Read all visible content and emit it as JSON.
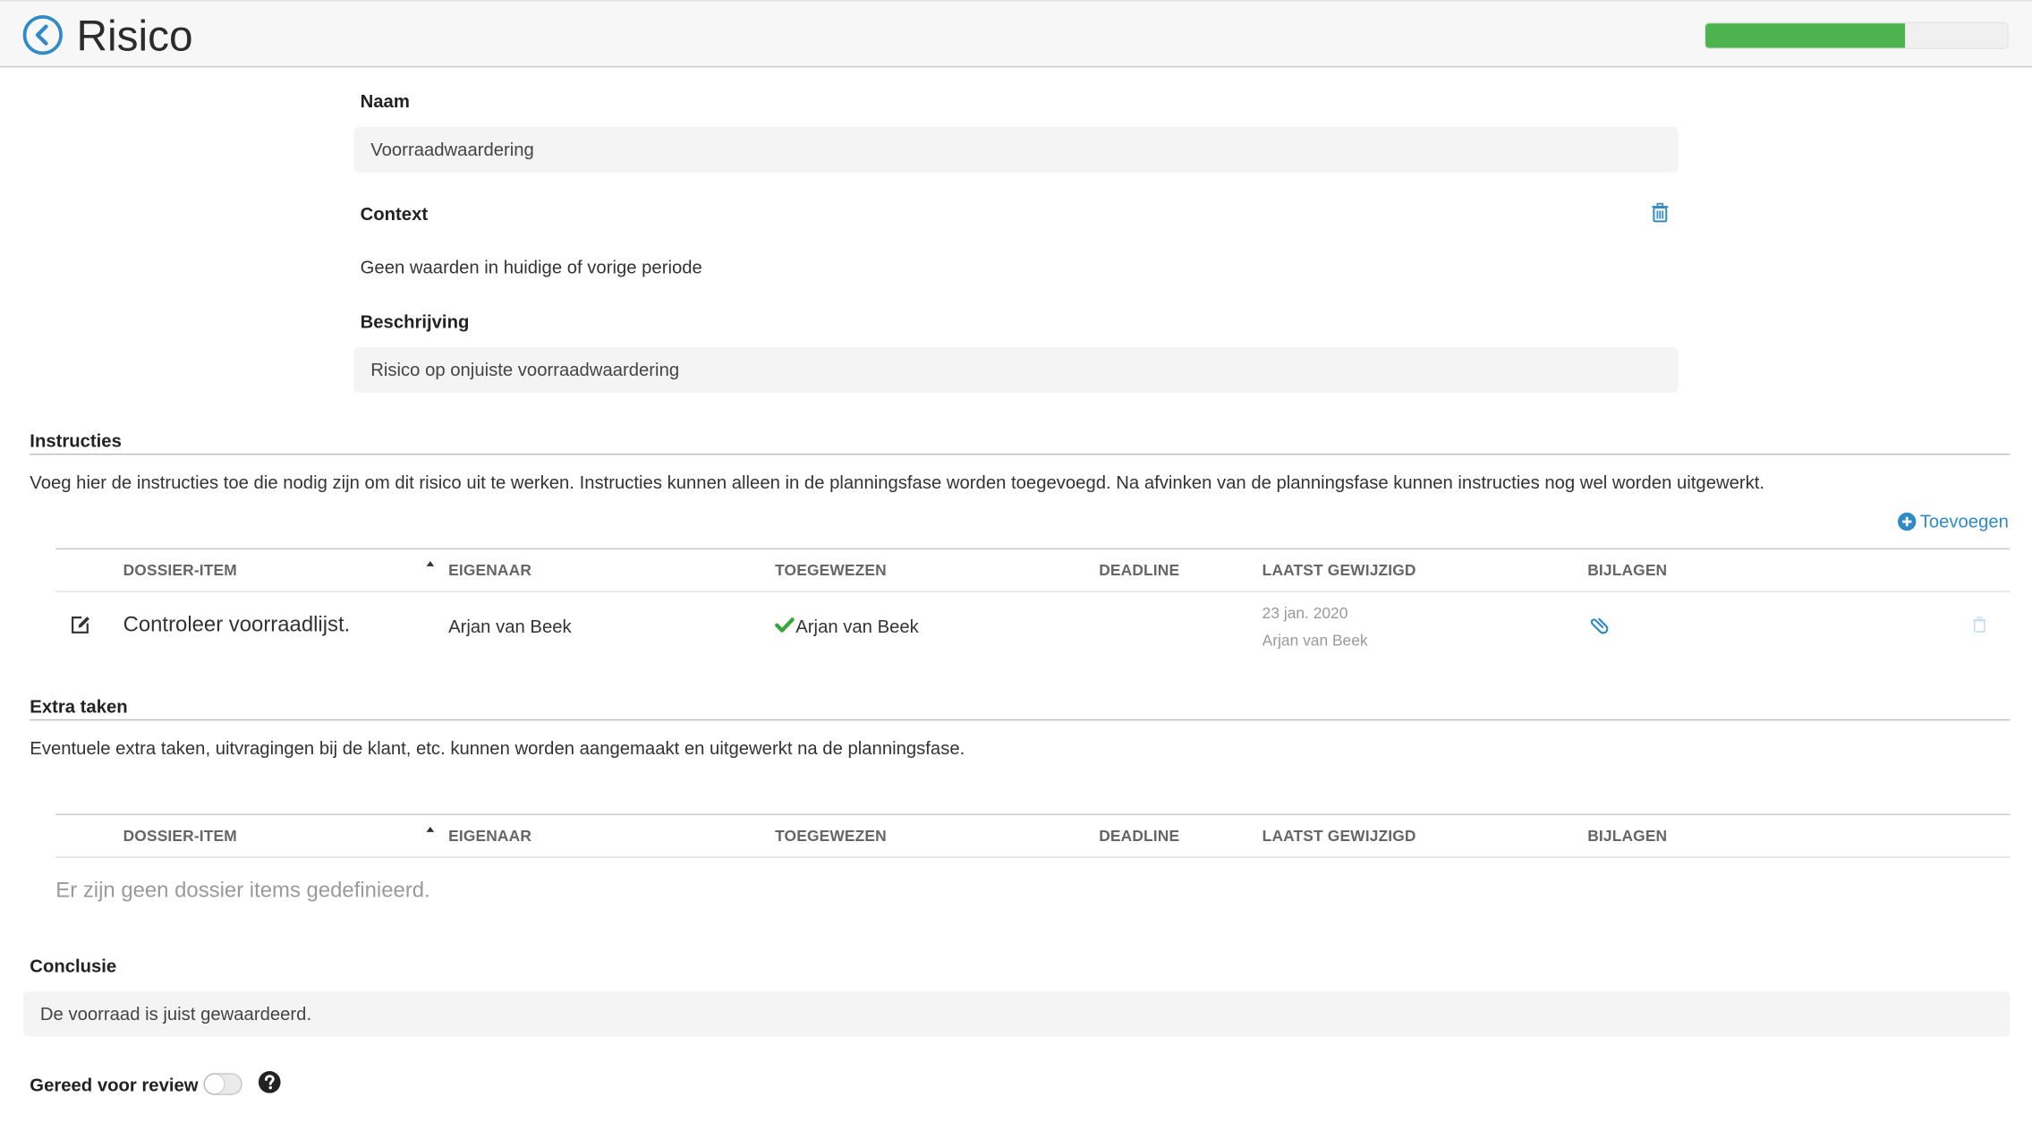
{
  "header": {
    "title": "Risico",
    "progress_fraction": 0.66,
    "progress_color": "#4cb34f",
    "back_icon": "chevron-left-circle-icon"
  },
  "form": {
    "naam_label": "Naam",
    "naam_value": "Voorraadwaardering",
    "context_label": "Context",
    "context_value": "Geen waarden in huidige of vorige periode",
    "beschrijving_label": "Beschrijving",
    "beschrijving_value": "Risico op onjuiste voorraadwaardering"
  },
  "instructies": {
    "title": "Instructies",
    "description": "Voeg hier de instructies toe die nodig zijn om dit risico uit te werken. Instructies kunnen alleen in de planningsfase worden toegevoegd. Na afvinken van de planningsfase kunnen instructies nog wel worden uitgewerkt.",
    "add_label": "Toevoegen",
    "columns": [
      "DOSSIER-ITEM",
      "EIGENAAR",
      "TOEGEWEZEN",
      "DEADLINE",
      "LAATST GEWIJZIGD",
      "BIJLAGEN"
    ],
    "rows": [
      {
        "item": "Controleer voorraadlijst.",
        "eigenaar": "Arjan van Beek",
        "toegewezen": "Arjan van Beek",
        "deadline": "",
        "gewijzigd_datum": "23 jan. 2020",
        "gewijzigd_door": "Arjan van Beek"
      }
    ]
  },
  "extra_taken": {
    "title": "Extra taken",
    "description": "Eventuele extra taken, uitvragingen bij de klant, etc. kunnen worden aangemaakt en uitgewerkt na de planningsfase.",
    "columns": [
      "DOSSIER-ITEM",
      "EIGENAAR",
      "TOEGEWEZEN",
      "DEADLINE",
      "LAATST GEWIJZIGD",
      "BIJLAGEN"
    ],
    "empty_text": "Er zijn geen dossier items gedefinieerd."
  },
  "conclusie": {
    "title": "Conclusie",
    "value": "De voorraad is juist gewaardeerd."
  },
  "review": {
    "label": "Gereed voor review",
    "enabled": false
  },
  "colors": {
    "accent": "#2f8ac6",
    "check": "#3aa53a"
  }
}
